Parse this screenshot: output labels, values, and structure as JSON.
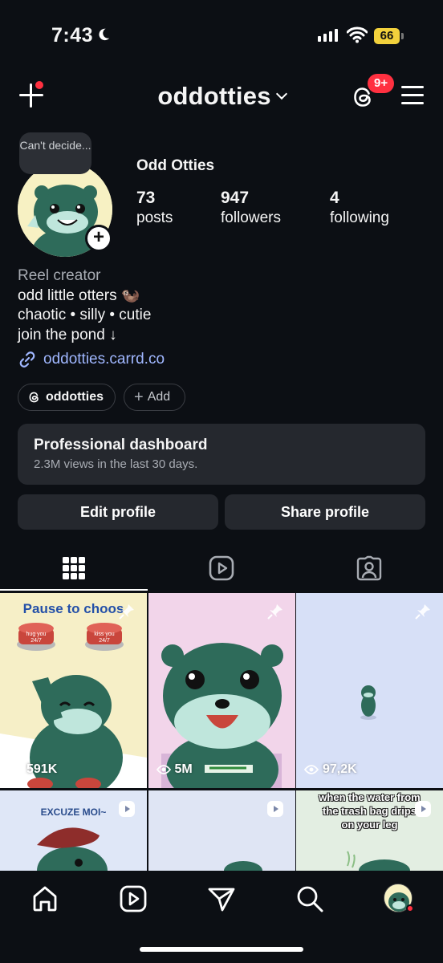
{
  "status_bar": {
    "time": "7:43",
    "battery": "66"
  },
  "header": {
    "username": "oddotties",
    "notification_badge": "9+"
  },
  "profile": {
    "note": "Can't decide...",
    "display_name": "Odd Otties",
    "stats": [
      {
        "value": "73",
        "label": "posts"
      },
      {
        "value": "947",
        "label": "followers"
      },
      {
        "value": "4",
        "label": "following"
      }
    ],
    "bio": {
      "category": "Reel creator",
      "lines": [
        "odd little otters 🦦",
        "chaotic • silly • cutie",
        "join the pond ↓"
      ]
    },
    "link": "oddotties.carrd.co",
    "threads_chip": "oddotties",
    "add_chip": "Add"
  },
  "dashboard": {
    "title": "Professional dashboard",
    "subtitle": "2.3M views in the last 30 days."
  },
  "buttons": {
    "edit": "Edit profile",
    "share": "Share profile"
  },
  "grid": {
    "items": [
      {
        "title": "Pause to choos",
        "views": "591K",
        "pinned": true,
        "bg": "#f6efc7",
        "btn_left": "hug you 24/7",
        "btn_right": "kiss you 24/7"
      },
      {
        "views": "5M",
        "pinned": true,
        "bg": "#f2d5ea"
      },
      {
        "views": "97,2K",
        "pinned": true,
        "bg": "#d7e0f7"
      },
      {
        "title": "EXCUZE MOI~",
        "reel": true,
        "bg": "#dfe7f7"
      },
      {
        "reel": true,
        "bg": "#dfe5f4"
      },
      {
        "caption": "when the water from the trash bag drips on your leg",
        "reel": true,
        "bg": "#e3eee2"
      }
    ]
  },
  "colors": {
    "background": "#0c0f14",
    "card": "#25282e",
    "accent_link": "#a0b7ff",
    "badge_red": "#ff3040",
    "otter_green": "#2e6b5a"
  }
}
